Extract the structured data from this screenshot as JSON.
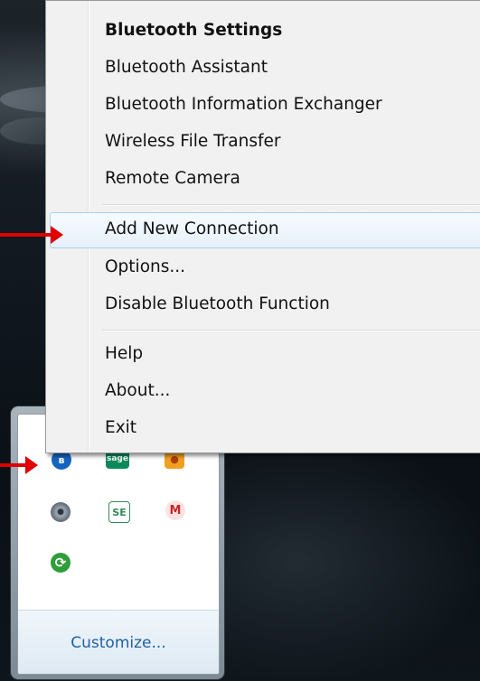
{
  "menu": {
    "items": [
      {
        "label": "Bluetooth Settings",
        "bold": true
      },
      {
        "label": "Bluetooth Assistant"
      },
      {
        "label": "Bluetooth Information Exchanger"
      },
      {
        "label": "Wireless File Transfer"
      },
      {
        "label": "Remote Camera"
      },
      {
        "label": "Add New Connection",
        "highlighted": true
      },
      {
        "label": "Options..."
      },
      {
        "label": "Disable Bluetooth Function"
      },
      {
        "label": "Help"
      },
      {
        "label": "About..."
      },
      {
        "label": "Exit"
      }
    ]
  },
  "tray": {
    "icons": [
      {
        "name": "bluetooth-icon",
        "color": "#1565c0",
        "glyph": "ʙ"
      },
      {
        "name": "sage-icon",
        "color": "#0a8a5a",
        "glyph": "sage"
      },
      {
        "name": "orange-app-icon",
        "color": "#f0a020",
        "glyph": "●"
      },
      {
        "name": "webcam-icon",
        "color": "#6f7a86",
        "glyph": "●"
      },
      {
        "name": "se-icon",
        "color": "#2e8b57",
        "glyph": "SE"
      },
      {
        "name": "gmail-notifier-icon",
        "color": "#c62828",
        "glyph": "M"
      },
      {
        "name": "sync-icon",
        "color": "#2e9e3a",
        "glyph": "⟳"
      }
    ],
    "customize_label": "Customize..."
  },
  "annotation": {
    "arrow_color": "#e00000"
  }
}
